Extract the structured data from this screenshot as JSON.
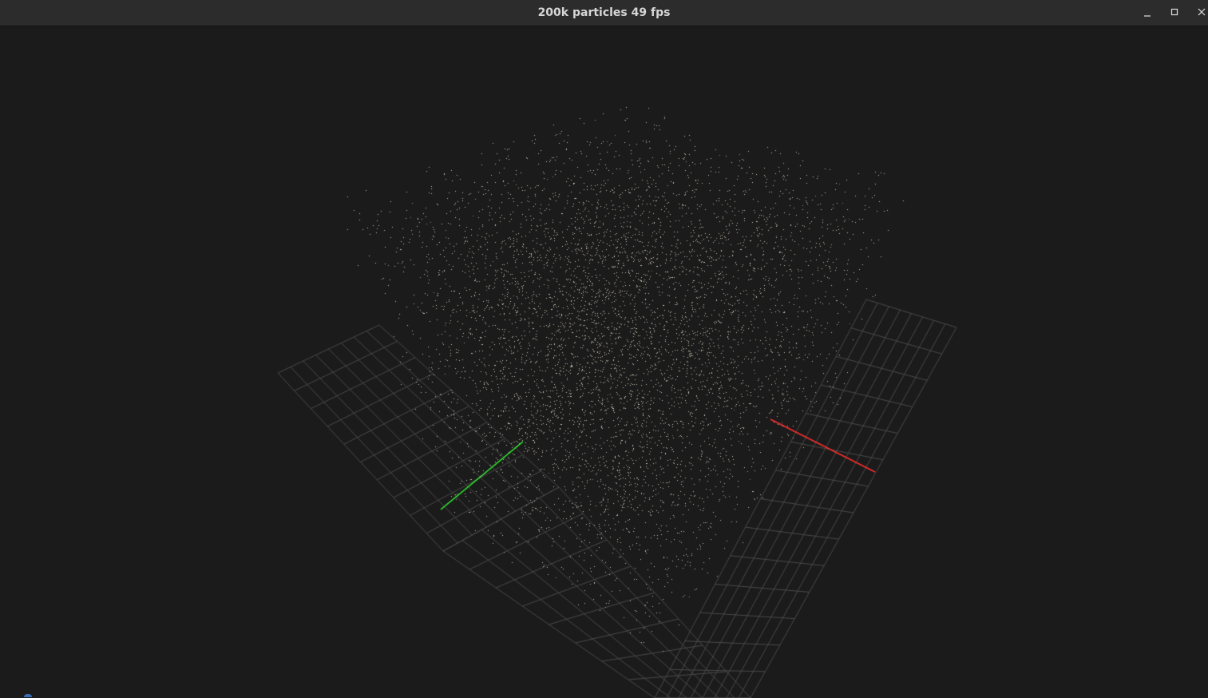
{
  "window": {
    "title": "200k particles 49 fps",
    "controls": {
      "minimize_icon": "minimize-icon",
      "maximize_icon": "maximize-icon",
      "close_icon": "close-icon"
    }
  },
  "scene": {
    "background_color": "#1b1b1b",
    "particle_color": "#c8c3b2",
    "grid_color": "#4a4a4a",
    "axis_colors": {
      "x": "#ff3030",
      "y": "#30ff30"
    }
  }
}
